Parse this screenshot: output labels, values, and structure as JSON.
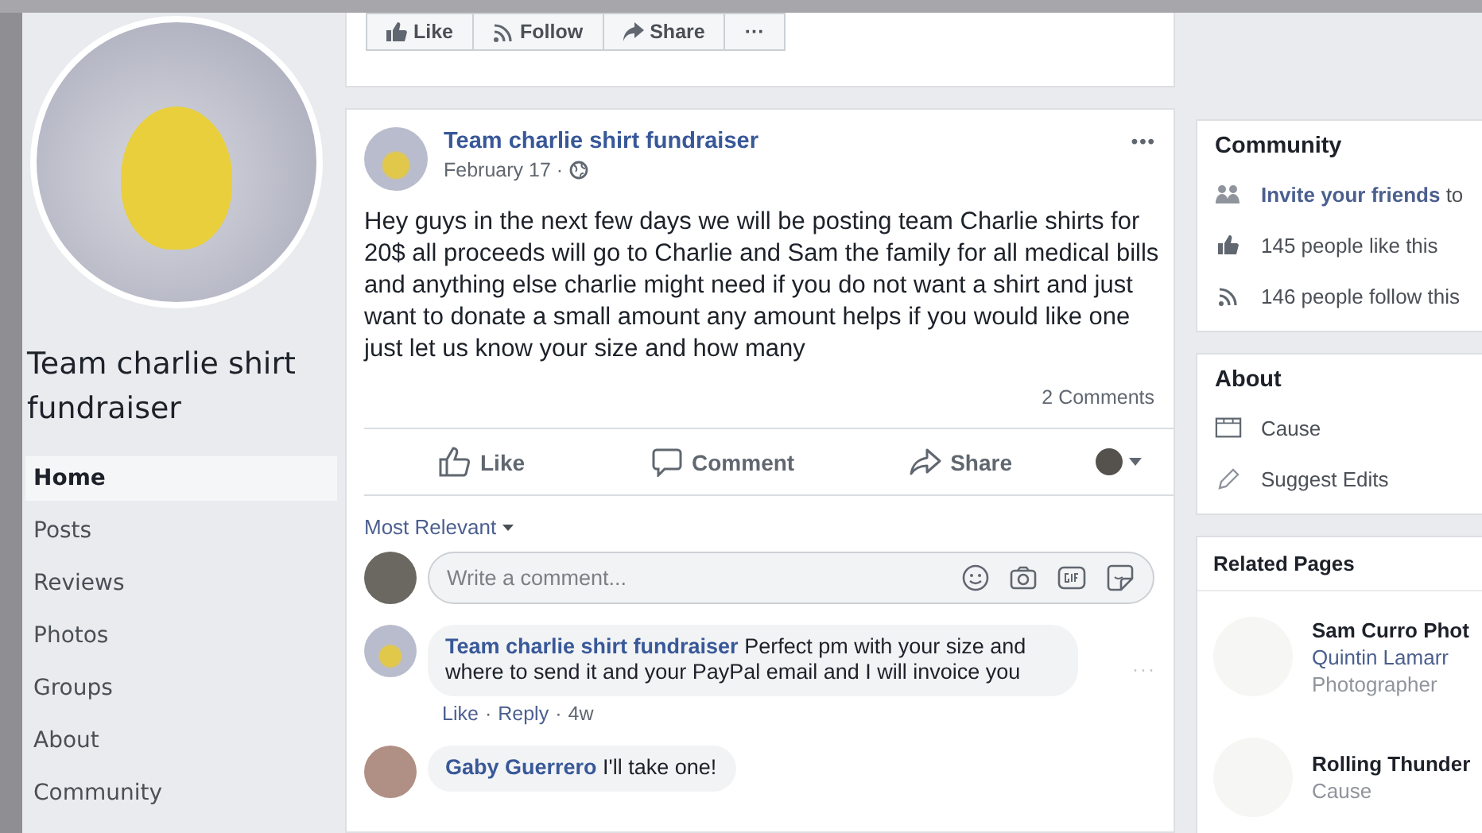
{
  "sidebar": {
    "page_name": "Team charlie shirt fundraiser",
    "nav": [
      {
        "label": "Home",
        "selected": true
      },
      {
        "label": "Posts",
        "selected": false
      },
      {
        "label": "Reviews",
        "selected": false
      },
      {
        "label": "Photos",
        "selected": false
      },
      {
        "label": "Groups",
        "selected": false
      },
      {
        "label": "About",
        "selected": false
      },
      {
        "label": "Community",
        "selected": false
      }
    ]
  },
  "page_actions": [
    {
      "label": "Like"
    },
    {
      "label": "Follow"
    },
    {
      "label": "Share"
    },
    {
      "label": "···"
    }
  ],
  "post": {
    "author": "Team charlie shirt fundraiser",
    "date": "February 17 ·",
    "menu": "•••",
    "text": "Hey guys in the next few days we will be posting team Charlie shirts for 20$ all proceeds will go to Charlie and Sam the family for all medical bills and anything else charlie might need if you do not want a shirt and just want to donate a small amount any amount helps if you would like one just let us know your size and how many",
    "comments_count": "2 Comments",
    "actions": [
      {
        "label": "Like"
      },
      {
        "label": "Comment"
      },
      {
        "label": "Share"
      }
    ],
    "sort": "Most Relevant",
    "comment_placeholder": "Write a comment...",
    "comments": [
      {
        "author": "Team charlie shirt fundraiser",
        "text": "Perfect pm with your size and where to send it and your PayPal email and I will invoice you",
        "menu": "···",
        "links": [
          "Like",
          "Reply"
        ],
        "separator": "·",
        "time": "4w"
      },
      {
        "author": "Gaby Guerrero",
        "text": "I'll take one!"
      }
    ]
  },
  "community": {
    "title": "Community",
    "items": [
      {
        "text": "**Invite your friends** to"
      },
      {
        "text": "145 people like this"
      },
      {
        "text": "146 people follow this"
      }
    ]
  },
  "about": {
    "title": "About",
    "items": [
      {
        "text": "Cause"
      },
      {
        "text": "Suggest Edits"
      }
    ]
  },
  "related_pages": {
    "title": "Related Pages",
    "pages": [
      {
        "name": "Sam Curro Phot",
        "liker": "Quintin Lamarr",
        "category": "Photographer"
      },
      {
        "name": "Rolling Thunder",
        "category": "Cause"
      }
    ]
  }
}
